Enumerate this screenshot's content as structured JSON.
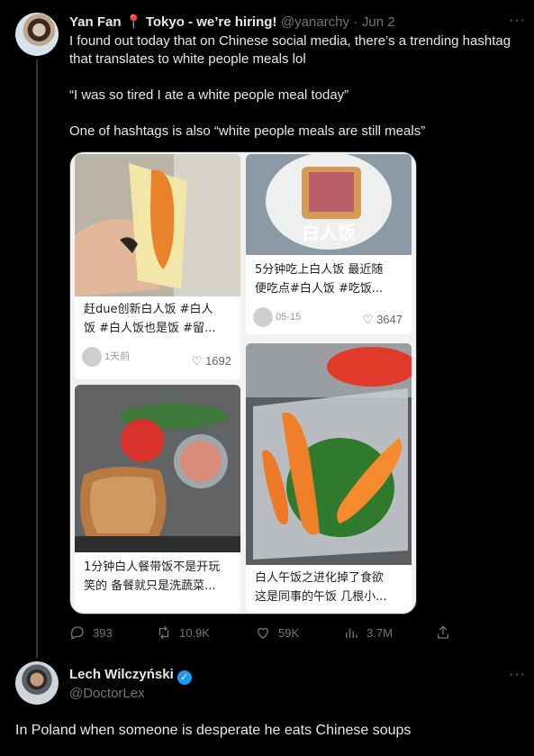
{
  "tweet1": {
    "author_name": "Yan Fan",
    "author_extra": "📍 Tokyo - we’re hiring!",
    "handle": "@yanarchy",
    "dot": "·",
    "date": "Jun 2",
    "more": "···",
    "lines": [
      "I found out today that on Chinese social media, there’s a trending hashtag",
      "that translates to white people meals lol",
      "“I was so tired I ate a white people meal today”",
      "One of hashtags is also “white people meals are still meals”"
    ],
    "cards": [
      {
        "caption1": "赶due创新白人饭 #白人",
        "caption2": "饭 #白人饭也是饭 #留...",
        "time": "1天前",
        "likes": "1692"
      },
      {
        "overlay": "白人饭",
        "caption1": "5分钟吃上白人饭 最近随",
        "caption2": "便吃点#白人饭 #吃饭...",
        "time": "05-15",
        "likes": "3647"
      },
      {
        "caption1": "1分钟白人餐带饭不是开玩",
        "caption2": "笑的 备餐就只是洗蔬菜..."
      },
      {
        "caption1": "白人午饭之进化掉了食欲",
        "caption2": "这是同事的午饭 几根小..."
      }
    ],
    "actions": {
      "replies": "393",
      "retweets": "10.9K",
      "likes": "59K",
      "views": "3.7M"
    },
    "icons": [
      "reply-icon",
      "retweet-icon",
      "like-icon",
      "views-icon",
      "share-icon"
    ]
  },
  "tweet2": {
    "author_name": "Lech Wilczyński",
    "verified_icon": "✓",
    "handle": "@DoctorLex",
    "more": "···",
    "text": "In Poland when someone is desperate he eats Chinese soups"
  },
  "colors": {
    "background": "#000000",
    "text": "#e7e9ea",
    "muted": "#71767b",
    "verified": "#1d9bf0"
  }
}
